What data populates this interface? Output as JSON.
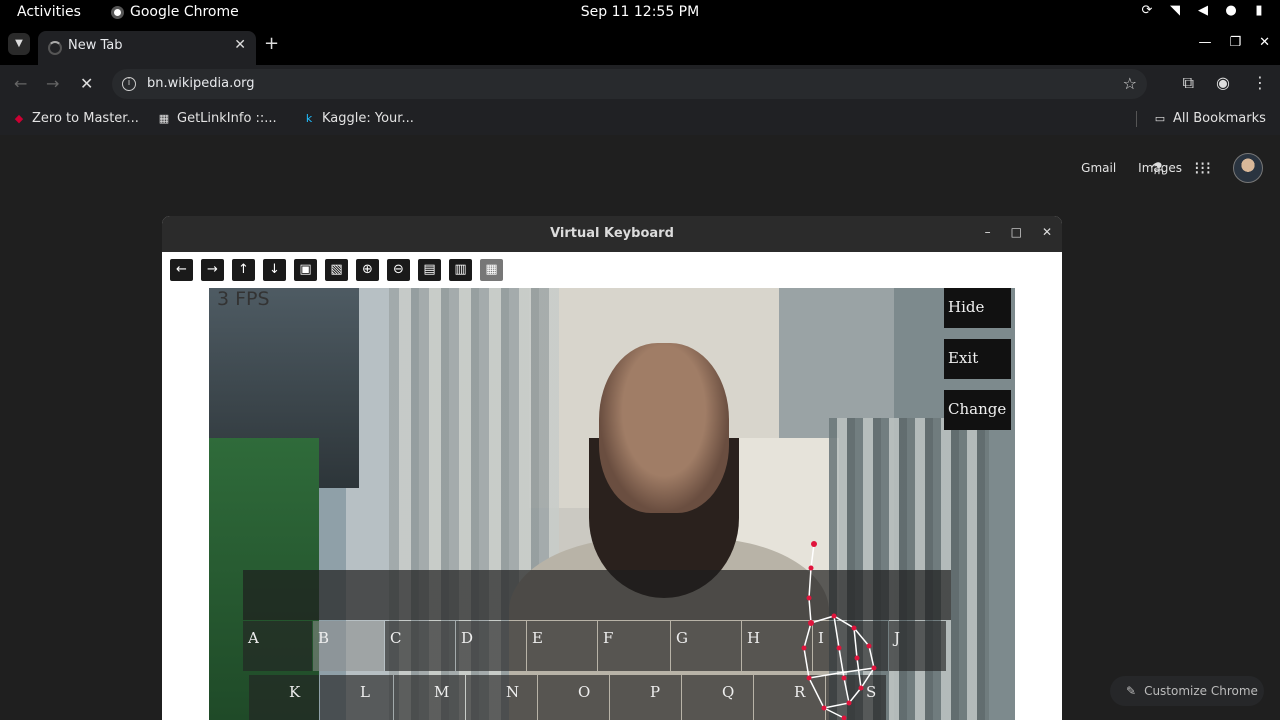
{
  "system_bar": {
    "activities": "Activities",
    "app_name": "Google Chrome",
    "clock": "Sep 11  12:55 PM"
  },
  "browser": {
    "tab_title": "New Tab",
    "url": "bn.wikipedia.org",
    "bookmarks": [
      {
        "label": "Zero to Master..."
      },
      {
        "label": "GetLinkInfo ::..."
      },
      {
        "label": "Kaggle: Your..."
      }
    ],
    "all_bookmarks": "All Bookmarks",
    "header_links": [
      "Gmail",
      "Images"
    ],
    "customize_label": "Customize Chrome"
  },
  "virtual_keyboard": {
    "title": "Virtual Keyboard",
    "fps": "3 FPS",
    "side_buttons": [
      "Hide",
      "Exit",
      "Change"
    ],
    "row1": [
      "A",
      "B",
      "C",
      "D",
      "E",
      "F",
      "G",
      "H",
      "I",
      "J"
    ],
    "row2": [
      "K",
      "L",
      "M",
      "N",
      "O",
      "P",
      "Q",
      "R",
      "S"
    ],
    "highlighted_key": "B"
  },
  "colors": {
    "chrome_dark": "#202124",
    "titlebar": "#2b2b2b",
    "hand_landmark": "#e0143c"
  }
}
